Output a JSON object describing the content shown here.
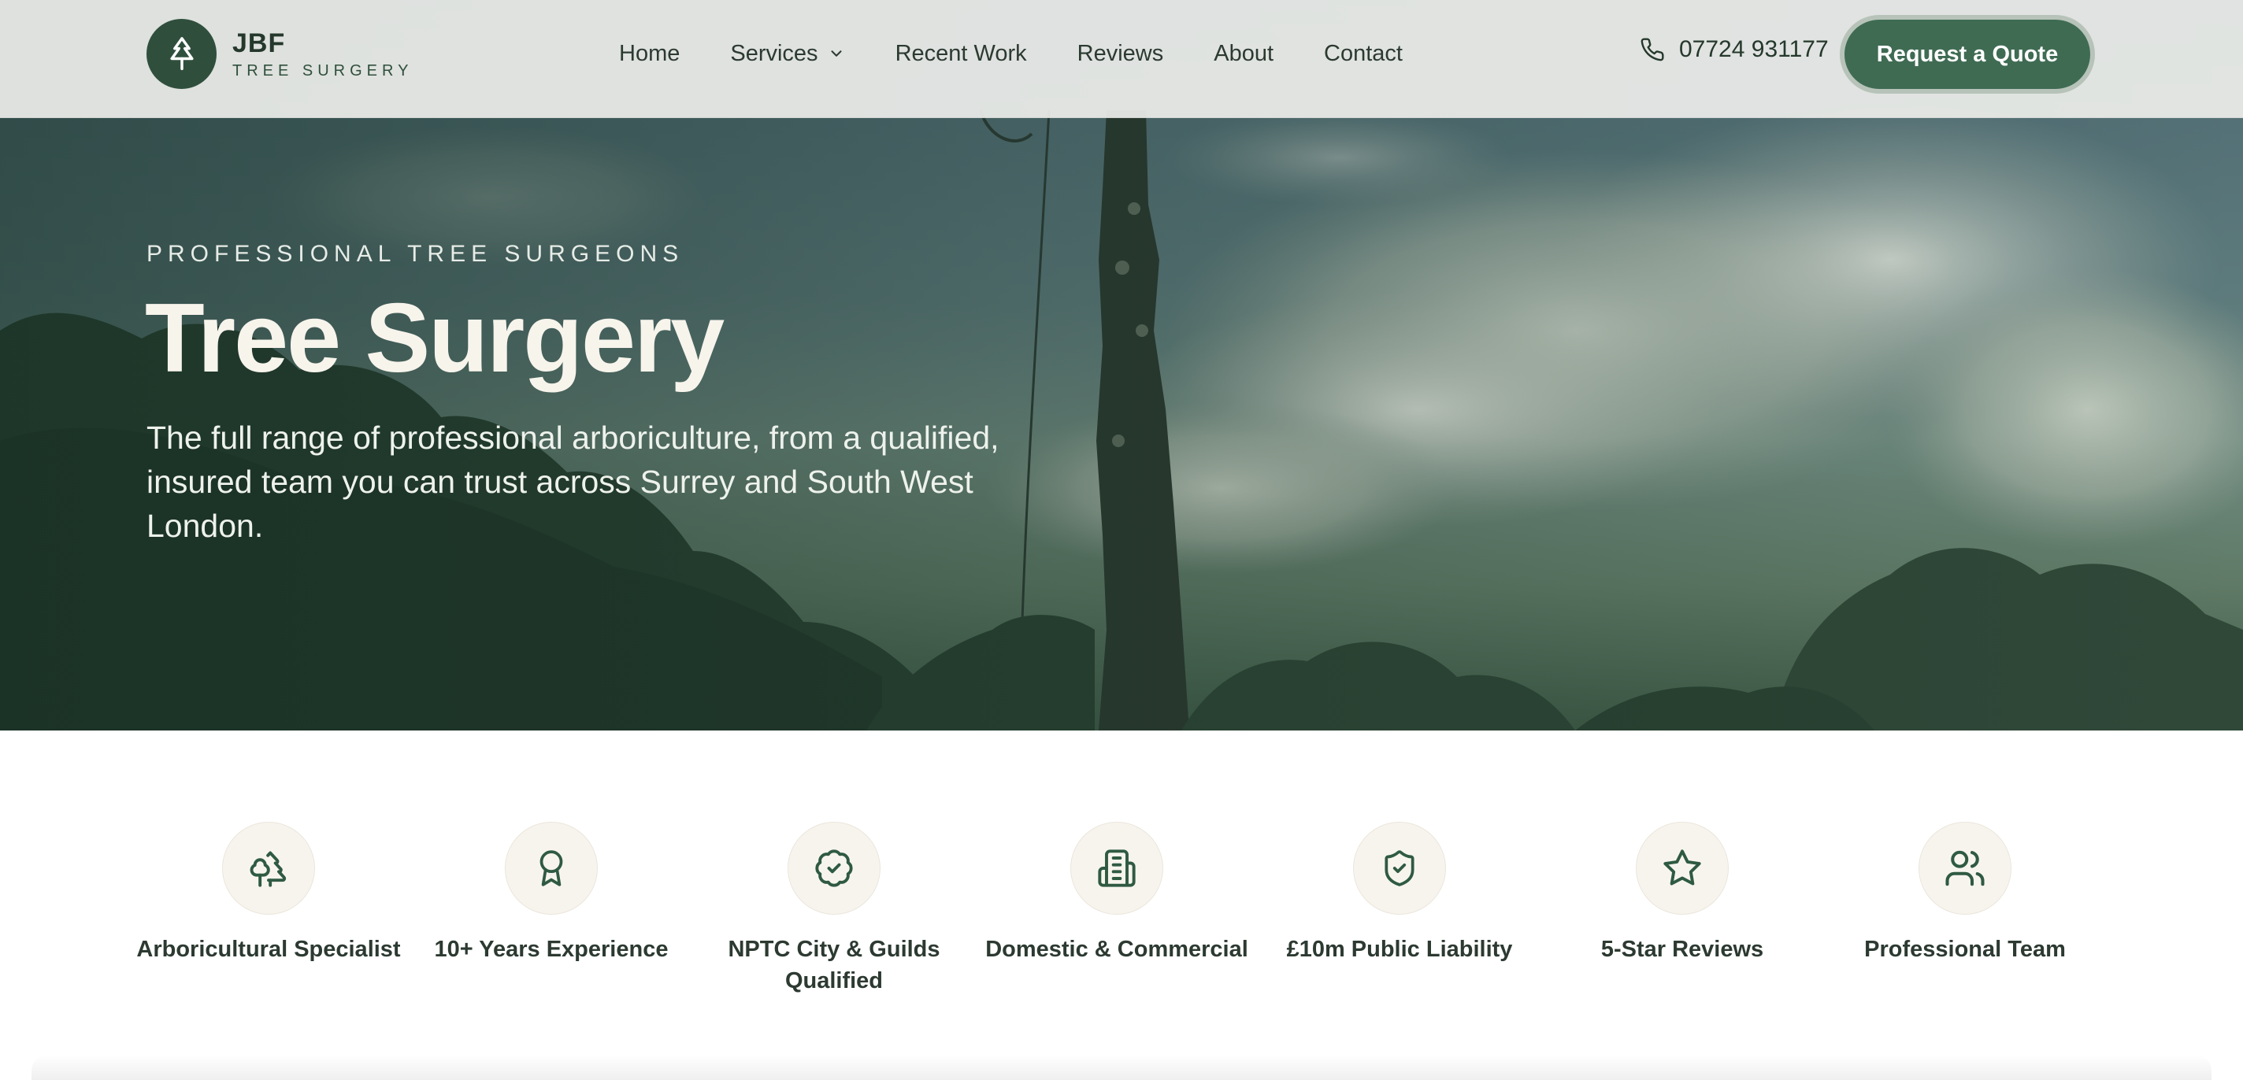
{
  "header": {
    "brand_name": "JBF",
    "brand_sub": "TREE SURGERY",
    "nav": [
      {
        "label": "Home"
      },
      {
        "label": "Services"
      },
      {
        "label": "Recent Work"
      },
      {
        "label": "Reviews"
      },
      {
        "label": "About"
      },
      {
        "label": "Contact"
      }
    ],
    "phone": "07724 931177",
    "cta_label": "Request a Quote"
  },
  "hero": {
    "eyebrow": "PROFESSIONAL TREE SURGEONS",
    "title": "Tree Surgery",
    "description": "The full range of professional arboriculture, from a qualified, insured team you can trust across Surrey and South West London."
  },
  "features": [
    {
      "label": "Arboricultural Specialist",
      "icon": "trees-icon"
    },
    {
      "label": "10+ Years Experience",
      "icon": "award-icon"
    },
    {
      "label": "NPTC City & Guilds Qualified",
      "icon": "badge-check-icon"
    },
    {
      "label": "Domestic & Commercial",
      "icon": "building-icon"
    },
    {
      "label": "£10m Public Liability",
      "icon": "shield-check-icon"
    },
    {
      "label": "5-Star Reviews",
      "icon": "star-icon"
    },
    {
      "label": "Professional Team",
      "icon": "users-icon"
    }
  ],
  "colors": {
    "brand_green": "#2f4f3c",
    "button_green": "#3f6b53",
    "icon_bg": "#f7f4ee"
  }
}
